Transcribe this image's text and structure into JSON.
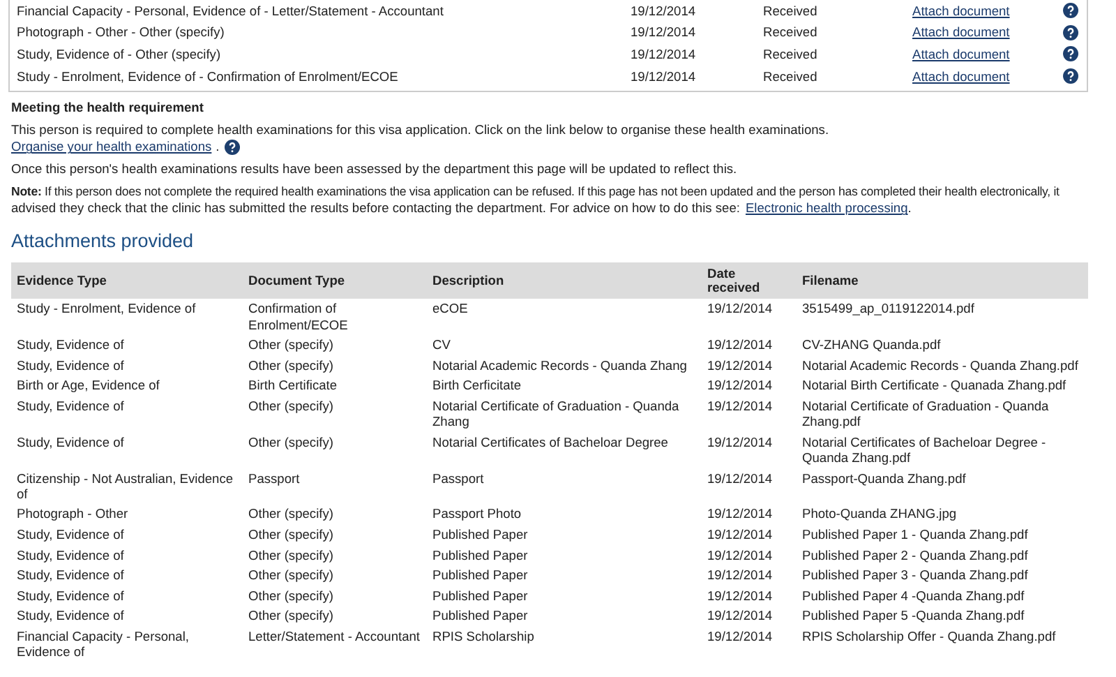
{
  "checklist": [
    {
      "item": "Financial Capacity - Personal, Evidence of - Letter/Statement - Accountant",
      "date": "19/12/2014",
      "status": "Received",
      "link": "Attach document"
    },
    {
      "item": "Photograph - Other - Other (specify)",
      "date": "19/12/2014",
      "status": "Received",
      "link": "Attach document"
    },
    {
      "item": "Study, Evidence of - Other (specify)",
      "date": "19/12/2014",
      "status": "Received",
      "link": "Attach document"
    },
    {
      "item": "Study - Enrolment, Evidence of - Confirmation of Enrolment/ECOE",
      "date": "19/12/2014",
      "status": "Received",
      "link": "Attach document"
    }
  ],
  "health": {
    "title": "Meeting the health requirement",
    "intro": "This person is required to complete health examinations for this visa application. Click on the link below to organise these health examinations.",
    "link": "Organise your health examinations",
    "link_suffix": ".",
    "update": "Once this person's health examinations results have been assessed by the department this page will be updated to reflect this.",
    "note_line1": "**Note:** If this person does not complete the required health examinations the visa application can be refused. If this page has not been updated and the person has completed their health electronically, it",
    "note_line2": "advised they check that the clinic has submitted the results before contacting the department. For advice on how to do this see:",
    "note_link": "Electronic health processing",
    "note_suffix": "."
  },
  "attachments": {
    "title": "Attachments provided",
    "columns": [
      "Evidence Type",
      "Document Type",
      "Description",
      "Date received",
      "Filename"
    ],
    "rows": [
      [
        "Study - Enrolment, Evidence of",
        "Confirmation of Enrolment/ECOE",
        "eCOE",
        "19/12/2014",
        "3515499_ap_0119122014.pdf"
      ],
      [
        "Study, Evidence of",
        "Other (specify)",
        "CV",
        "19/12/2014",
        "CV-ZHANG Quanda.pdf"
      ],
      [
        "Study, Evidence of",
        "Other (specify)",
        "Notarial Academic Records - Quanda Zhang",
        "19/12/2014",
        "Notarial Academic Records - Quanda Zhang.pdf"
      ],
      [
        "Birth or Age, Evidence of",
        "Birth Certificate",
        "Birth Cerficitate",
        "19/12/2014",
        "Notarial Birth Certificate - Quanada Zhang.pdf"
      ],
      [
        "Study, Evidence of",
        "Other (specify)",
        "Notarial Certificate of Graduation - Quanda Zhang",
        "19/12/2014",
        "Notarial Certificate of Graduation - Quanda Zhang.pdf"
      ],
      [
        "Study, Evidence of",
        "Other (specify)",
        "Notarial Certificates of Bacheloar Degree",
        "19/12/2014",
        "Notarial Certificates of Bacheloar Degree - Quanda Zhang.pdf"
      ],
      [
        "Citizenship - Not Australian, Evidence of",
        "Passport",
        "Passport",
        "19/12/2014",
        "Passport-Quanda Zhang.pdf"
      ],
      [
        "Photograph - Other",
        "Other (specify)",
        "Passport Photo",
        "19/12/2014",
        "Photo-Quanda ZHANG.jpg"
      ],
      [
        "Study, Evidence of",
        "Other (specify)",
        "Published Paper",
        "19/12/2014",
        "Published Paper 1 - Quanda Zhang.pdf"
      ],
      [
        "Study, Evidence of",
        "Other (specify)",
        "Published Paper",
        "19/12/2014",
        "Published Paper 2 - Quanda Zhang.pdf"
      ],
      [
        "Study, Evidence of",
        "Other (specify)",
        "Published Paper",
        "19/12/2014",
        "Published Paper 3 - Quanda Zhang.pdf"
      ],
      [
        "Study, Evidence of",
        "Other (specify)",
        "Published Paper",
        "19/12/2014",
        "Published Paper 4 -Quanda Zhang.pdf"
      ],
      [
        "Study, Evidence of",
        "Other (specify)",
        "Published Paper",
        "19/12/2014",
        "Published Paper 5 -Quanda Zhang.pdf"
      ],
      [
        "Financial Capacity - Personal, Evidence of",
        "Letter/Statement - Accountant",
        "RPIS Scholarship",
        "19/12/2014",
        "RPIS Scholarship Offer - Quanda Zhang.pdf"
      ]
    ]
  }
}
